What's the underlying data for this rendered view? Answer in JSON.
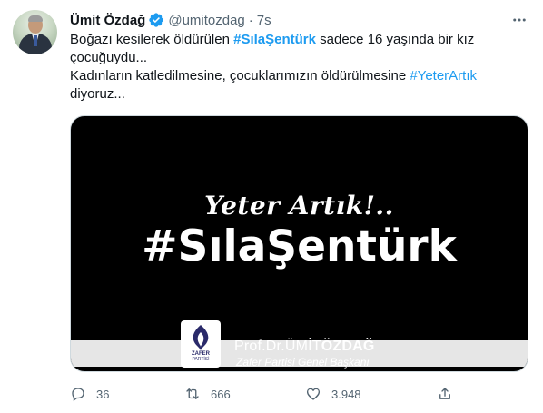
{
  "tweet": {
    "author_name": "Ümit Özdağ",
    "handle": "@umitozdag",
    "separator": "·",
    "time": "7s",
    "text": {
      "line1_before": "Boğazı kesilerek öldürülen ",
      "line1_tag": "#SılaŞentürk",
      "line1_after": " sadece 16 yaşında bir kız çocuğuydu...",
      "line2_before": "Kadınların katledilmesine, çocuklarımızın öldürülmesine ",
      "line2_tag": "#YeterArtık",
      "line2_after": " diyoruz..."
    },
    "media": {
      "headline": "Yeter Artık!..",
      "hashtag": "#SılaŞentürk",
      "logo_text_line1": "ZAFER",
      "logo_text_line2": "PARTİSİ",
      "signature_prefix": "Prof.Dr.",
      "signature_first": "ÜMİT",
      "signature_last": "ÖZDAĞ",
      "signature_title": "Zafer Partisi Genel Başkanı"
    },
    "stats": {
      "replies": "36",
      "retweets": "666",
      "likes": "3.948"
    }
  },
  "icons": {
    "verified": "verified-badge-icon",
    "more": "more-dots-icon",
    "reply": "reply-icon",
    "retweet": "retweet-icon",
    "like": "heart-icon",
    "share": "share-icon"
  },
  "colors": {
    "link": "#1d9bf0",
    "text": "#0f1419",
    "secondary": "#536471",
    "media_bg": "#000000"
  }
}
